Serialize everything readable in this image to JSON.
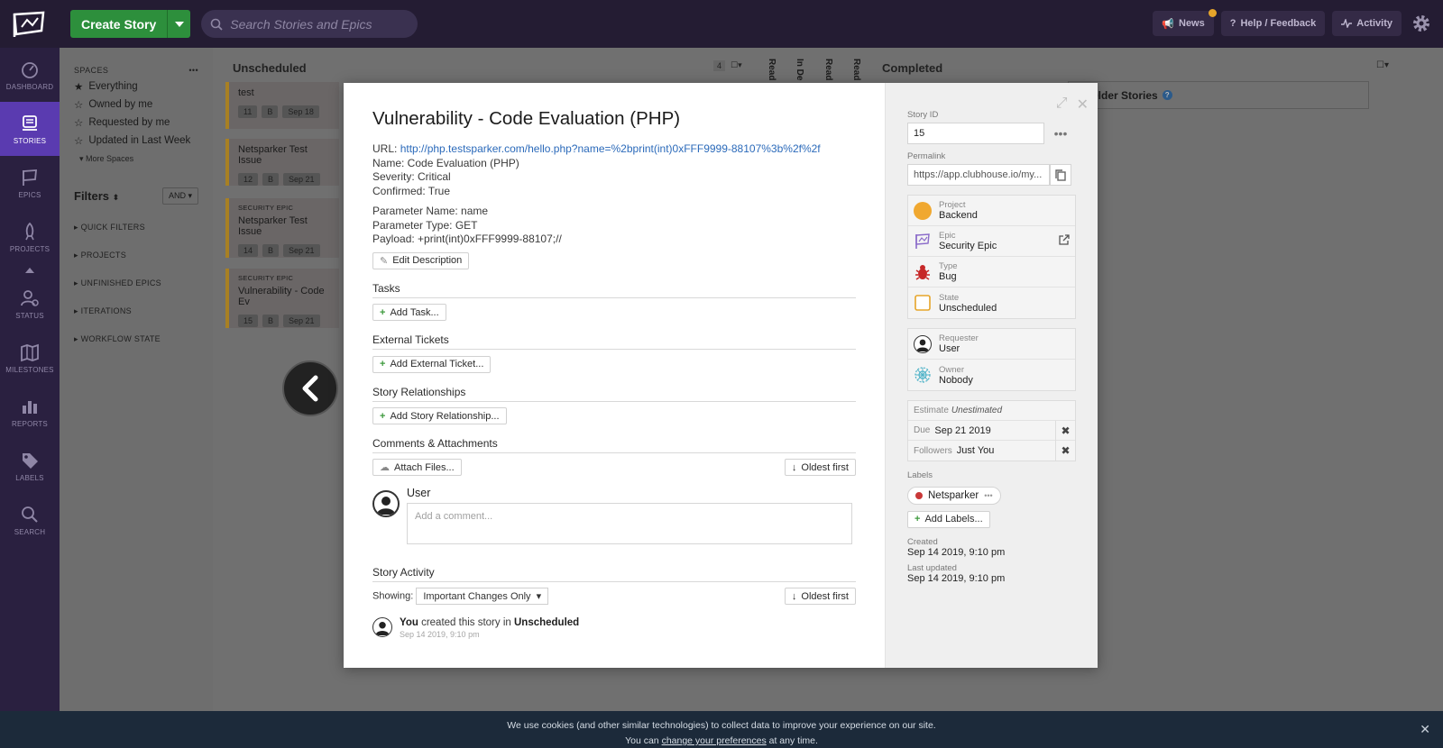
{
  "topbar": {
    "create_label": "Create Story",
    "search_placeholder": "Search Stories and Epics",
    "news_label": "News",
    "help_label": "Help / Feedback",
    "activity_label": "Activity"
  },
  "nav": {
    "items": [
      {
        "label": "DASHBOARD",
        "icon": "dashboard-icon"
      },
      {
        "label": "STORIES",
        "icon": "stories-icon",
        "active": true
      },
      {
        "label": "EPICS",
        "icon": "epics-flag-icon"
      },
      {
        "label": "PROJECTS",
        "icon": "rocket-icon"
      },
      {
        "label": "STATUS",
        "icon": "status-people-icon"
      },
      {
        "label": "MILESTONES",
        "icon": "map-icon"
      },
      {
        "label": "REPORTS",
        "icon": "bar-chart-icon"
      },
      {
        "label": "LABELS",
        "icon": "tag-icon"
      },
      {
        "label": "SEARCH",
        "icon": "search-icon"
      }
    ]
  },
  "spaces": {
    "header": "SPACES",
    "items": [
      "Everything",
      "Owned by me",
      "Requested by me",
      "Updated in Last Week"
    ],
    "more": "More Spaces"
  },
  "filters": {
    "title": "Filters",
    "mode": "AND",
    "sections": [
      "QUICK FILTERS",
      "PROJECTS",
      "UNFINISHED EPICS",
      "ITERATIONS",
      "WORKFLOW STATE"
    ]
  },
  "board": {
    "unscheduled_title": "Unscheduled",
    "unscheduled_count": "4",
    "vertical_cols": [
      "Read",
      "In De",
      "Read",
      "Read"
    ],
    "completed_title": "Completed",
    "load_older": "ad Older Stories",
    "cards": [
      {
        "epic": "",
        "title": "test",
        "id": "11",
        "type": "B",
        "date": "Sep 18"
      },
      {
        "epic": "",
        "title": "Netsparker Test Issue",
        "id": "12",
        "type": "B",
        "date": "Sep 21"
      },
      {
        "epic": "SECURITY EPIC",
        "title": "Netsparker Test Issue",
        "id": "14",
        "type": "B",
        "date": "Sep 21"
      },
      {
        "epic": "SECURITY EPIC",
        "title": "Vulnerability - Code Ev",
        "id": "15",
        "type": "B",
        "date": "Sep 21"
      }
    ]
  },
  "story": {
    "title": "Vulnerability - Code Evaluation (PHP)",
    "url_label": "URL: ",
    "url": "http://php.testsparker.com/hello.php?name=%2bprint(int)0xFFF9999-88107%3b%2f%2f",
    "name_line": "Name: Code Evaluation (PHP)",
    "severity_line": "Severity: Critical",
    "confirmed_line": "Confirmed: True",
    "param_name_line": "Parameter Name: name",
    "param_type_line": "Parameter Type: GET",
    "payload_line": "Payload: +print(int)0xFFF9999-88107;//",
    "edit_description": "Edit Description",
    "tasks_title": "Tasks",
    "add_task": "Add Task...",
    "external_title": "External Tickets",
    "add_external": "Add External Ticket...",
    "relationships_title": "Story Relationships",
    "add_relationship": "Add Story Relationship...",
    "comments_title": "Comments & Attachments",
    "attach_files": "Attach Files...",
    "oldest_first": "Oldest first",
    "comment_user": "User",
    "comment_placeholder": "Add a comment...",
    "activity_title": "Story Activity",
    "showing_label": "Showing:",
    "showing_value": "Important Changes Only",
    "activity_oldest": "Oldest first",
    "activity_actor": "You",
    "activity_middle": " created this story in ",
    "activity_state": "Unscheduled",
    "activity_date": "Sep 14 2019, 9:10 pm"
  },
  "sidebar": {
    "story_id_label": "Story ID",
    "story_id": "15",
    "permalink_label": "Permalink",
    "permalink": "https://app.clubhouse.io/my...",
    "project_label": "Project",
    "project_value": "Backend",
    "project_color": "#f0a830",
    "epic_label": "Epic",
    "epic_value": "Security Epic",
    "type_label": "Type",
    "type_value": "Bug",
    "state_label": "State",
    "state_value": "Unscheduled",
    "requester_label": "Requester",
    "requester_value": "User",
    "owner_label": "Owner",
    "owner_value": "Nobody",
    "estimate_label": "Estimate",
    "estimate_value": "Unestimated",
    "due_label": "Due",
    "due_value": "Sep 21 2019",
    "followers_label": "Followers",
    "followers_value": "Just You",
    "labels_title": "Labels",
    "label_name": "Netsparker",
    "add_labels": "Add Labels...",
    "created_label": "Created",
    "created_value": "Sep 14 2019, 9:10 pm",
    "updated_label": "Last updated",
    "updated_value": "Sep 14 2019, 9:10 pm"
  },
  "cookie": {
    "line1": "We use cookies (and other similar technologies) to collect data to improve your experience on our site.",
    "line2_pre": "You can ",
    "line2_link": "change your preferences",
    "line2_post": " at any time."
  }
}
